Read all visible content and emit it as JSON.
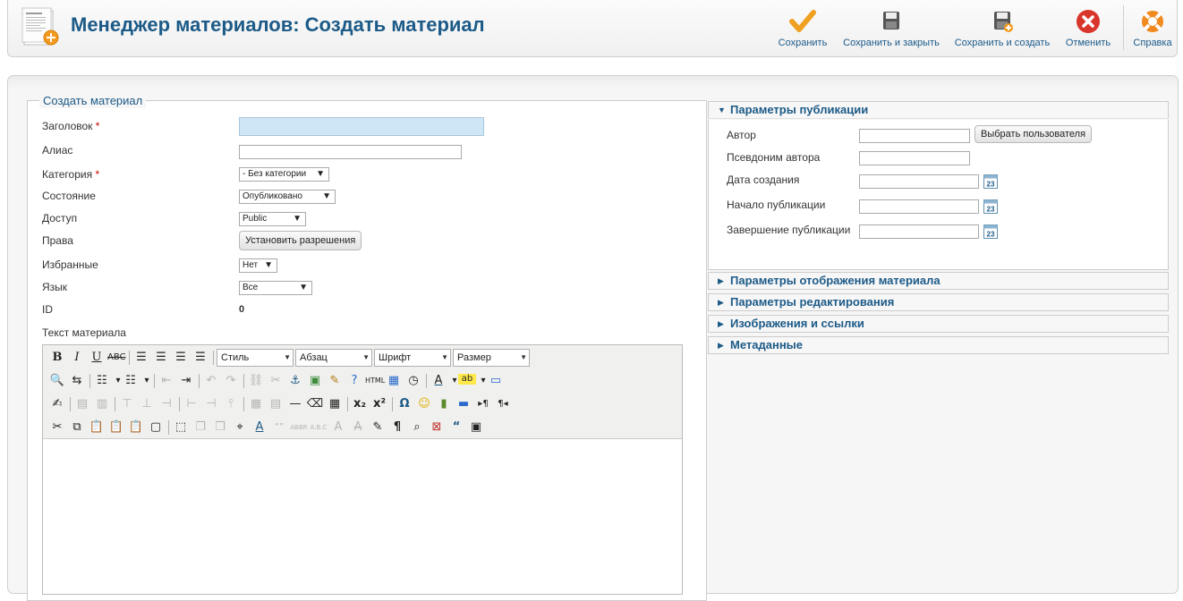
{
  "header": {
    "title": "Менеджер материалов: Создать материал",
    "buttons": [
      {
        "id": "save",
        "label": "Сохранить"
      },
      {
        "id": "save_close",
        "label": "Сохранить и закрыть"
      },
      {
        "id": "save_new",
        "label": "Сохранить и создать"
      },
      {
        "id": "cancel",
        "label": "Отменить"
      },
      {
        "id": "help",
        "label": "Справка"
      }
    ]
  },
  "form": {
    "legend": "Создать материал",
    "fields": {
      "title": {
        "label": "Заголовок",
        "required": "*",
        "value": ""
      },
      "alias": {
        "label": "Алиас",
        "value": ""
      },
      "category": {
        "label": "Категория",
        "required": "*",
        "value": "- Без категории"
      },
      "state": {
        "label": "Состояние",
        "value": "Опубликовано"
      },
      "access": {
        "label": "Доступ",
        "value": "Public"
      },
      "rules": {
        "label": "Права",
        "button": "Установить разрешения"
      },
      "featured": {
        "label": "Избранные",
        "value": "Нет"
      },
      "language": {
        "label": "Язык",
        "value": "Все"
      },
      "id": {
        "label": "ID",
        "value": "0"
      },
      "text": {
        "label": "Текст материала"
      }
    }
  },
  "editor": {
    "style": "Стиль",
    "format": "Абзац",
    "font": "Шрифт",
    "size": "Размер"
  },
  "sidebar": {
    "publishing": {
      "title": "Параметры публикации",
      "expanded": true,
      "author_label": "Автор",
      "author_value": "",
      "select_user_button": "Выбрать пользователя",
      "alias_label": "Псевдоним автора",
      "created_label": "Дата создания",
      "publish_up_label": "Начало публикации",
      "publish_down_label": "Завершение публикации",
      "calendar_day": "23"
    },
    "sections": [
      {
        "title": "Параметры отображения материала"
      },
      {
        "title": "Параметры редактирования"
      },
      {
        "title": "Изображения и ссылки"
      },
      {
        "title": "Метаданные"
      }
    ]
  },
  "colors": {
    "accent": "#1c5a87",
    "save_icon": "#f0a020",
    "cancel_icon": "#d9362b",
    "highlight_input": "#cfe6f7"
  }
}
